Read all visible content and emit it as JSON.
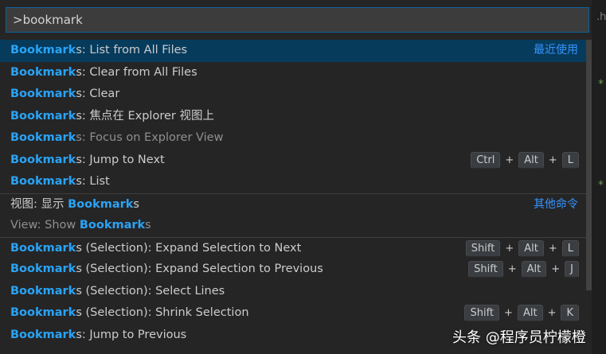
{
  "input": {
    "value": ">bookmark"
  },
  "rows": [
    {
      "hl": "Bookmark",
      "rest": "s: List from All Files",
      "tag": "最近使用",
      "selected": true
    },
    {
      "hl": "Bookmark",
      "rest": "s: Clear from All Files"
    },
    {
      "hl": "Bookmark",
      "rest": "s: Clear"
    },
    {
      "hl": "Bookmark",
      "rest": "s: 焦点在 Explorer 视图上"
    },
    {
      "hl": "Bookmark",
      "rest": "s: Focus on Explorer View",
      "muted": true
    },
    {
      "hl": "Bookmark",
      "rest": "s: Jump to Next",
      "keys": [
        "Ctrl",
        "Alt",
        "L"
      ]
    },
    {
      "hl": "Bookmark",
      "rest": "s: List"
    },
    {
      "pre": "视图: 显示 ",
      "hl": "Bookmark",
      "rest": "s",
      "tag": "其他命令",
      "groupTop": true
    },
    {
      "pre": "View: Show ",
      "hl": "Bookmark",
      "rest": "s",
      "muted": true
    },
    {
      "hl": "Bookmark",
      "rest": "s (Selection): Expand Selection to Next",
      "keys": [
        "Shift",
        "Alt",
        "L"
      ],
      "groupTop": true
    },
    {
      "hl": "Bookmark",
      "rest": "s (Selection): Expand Selection to Previous",
      "keys": [
        "Shift",
        "Alt",
        "J"
      ]
    },
    {
      "hl": "Bookmark",
      "rest": "s (Selection): Select Lines"
    },
    {
      "hl": "Bookmark",
      "rest": "s (Selection): Shrink Selection",
      "keys": [
        "Shift",
        "Alt",
        "K"
      ]
    },
    {
      "hl": "Bookmark",
      "rest": "s: Jump to Previous"
    }
  ],
  "keyPlus": "+",
  "editorPeek": {
    "tabFragment": ".h",
    "mark": "*"
  },
  "watermark": "头条 @程序员柠檬橙",
  "colors": {
    "accent": "#2aa3f5",
    "selected": "#063b5c",
    "tag": "#3794ff"
  }
}
